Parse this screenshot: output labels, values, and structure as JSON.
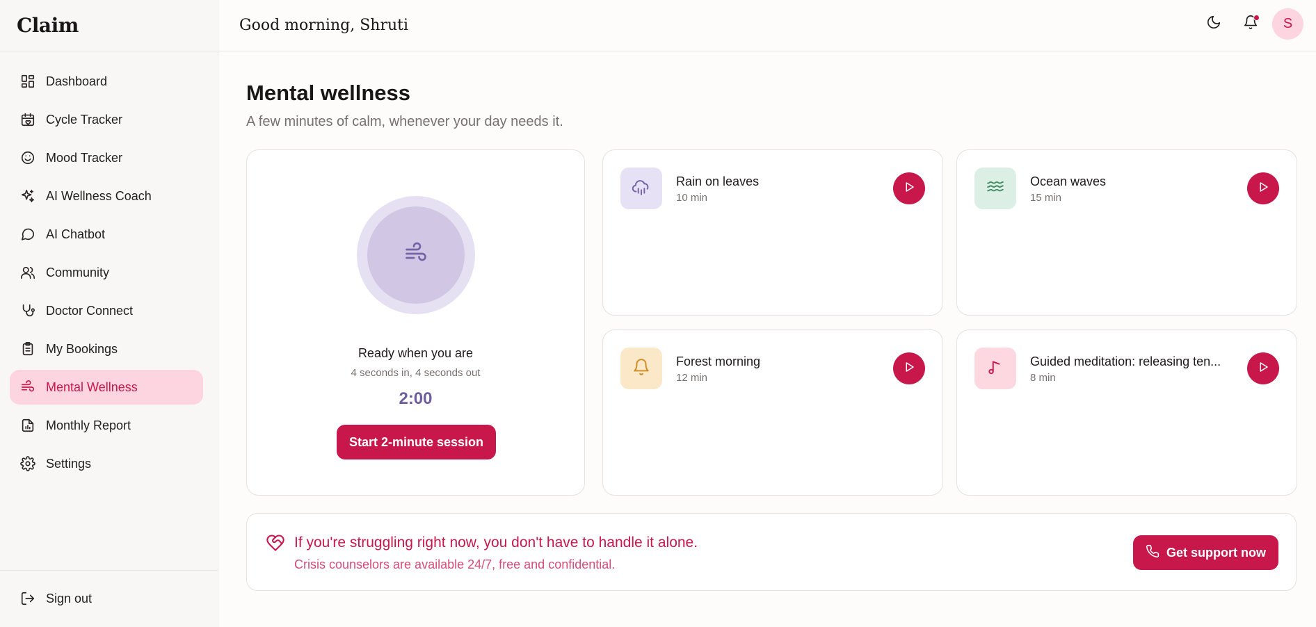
{
  "app": {
    "brand": "Claim"
  },
  "sidebar": {
    "items": [
      {
        "label": "Dashboard",
        "icon": "dashboard-icon",
        "active": false
      },
      {
        "label": "Cycle Tracker",
        "icon": "calendar-heart-icon",
        "active": false
      },
      {
        "label": "Mood Tracker",
        "icon": "smile-icon",
        "active": false
      },
      {
        "label": "AI Wellness Coach",
        "icon": "sparkles-icon",
        "active": false
      },
      {
        "label": "AI Chatbot",
        "icon": "chat-bubble-icon",
        "active": false
      },
      {
        "label": "Community",
        "icon": "users-icon",
        "active": false
      },
      {
        "label": "Doctor Connect",
        "icon": "stethoscope-icon",
        "active": false
      },
      {
        "label": "My Bookings",
        "icon": "clipboard-icon",
        "active": false
      },
      {
        "label": "Mental Wellness",
        "icon": "wind-icon",
        "active": true
      },
      {
        "label": "Monthly Report",
        "icon": "report-icon",
        "active": false
      },
      {
        "label": "Settings",
        "icon": "gear-icon",
        "active": false
      }
    ],
    "sign_out": "Sign out"
  },
  "header": {
    "greeting": "Good morning, Shruti",
    "avatar_initial": "S"
  },
  "main": {
    "title": "Mental wellness",
    "subtitle": "A few minutes of calm, whenever your day needs it.",
    "breathing": {
      "title": "Ready when you are",
      "hint": "4 seconds in, 4 seconds out",
      "timer": "2:00",
      "button": "Start 2-minute session"
    },
    "tracks": [
      {
        "name": "Rain on leaves",
        "duration": "10 min",
        "icon": "cloud-rain-icon",
        "bg": "#e7e1f5",
        "fg": "#7563a8"
      },
      {
        "name": "Ocean waves",
        "duration": "15 min",
        "icon": "waves-icon",
        "bg": "#dcefe4",
        "fg": "#3f8a62"
      },
      {
        "name": "Forest morning",
        "duration": "12 min",
        "icon": "bell-icon",
        "bg": "#fbe8c8",
        "fg": "#d08a1e"
      },
      {
        "name": "Guided meditation: releasing ten...",
        "duration": "8 min",
        "icon": "music-note-icon",
        "bg": "#fdd8e1",
        "fg": "#c8174a"
      }
    ],
    "crisis": {
      "title": "If you're struggling right now, you don't have to handle it alone.",
      "subtitle": "Crisis counselors are available 24/7, free and confidential.",
      "button": "Get support now"
    }
  },
  "colors": {
    "accent": "#c8174a",
    "active_bg": "#fdd5e0",
    "breath": "#6e5ea0"
  }
}
